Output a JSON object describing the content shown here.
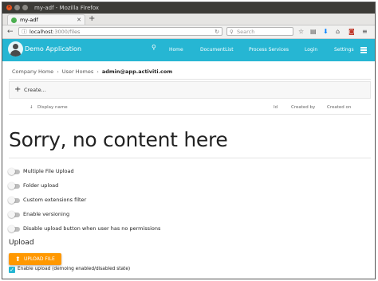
{
  "window": {
    "title": "my-adf - Mozilla Firefox"
  },
  "browser": {
    "tab_title": "my-adf",
    "url_host": "localhost",
    "url_path": ":3000/files",
    "search_placeholder": "Search"
  },
  "app": {
    "brand": "Demo Application",
    "menu": [
      "Home",
      "DocumentList",
      "Process Services",
      "Login",
      "Settings"
    ]
  },
  "breadcrumb": [
    "Company Home",
    "User Homes",
    "admin@app.activiti.com"
  ],
  "create_label": "Create...",
  "table": {
    "columns": [
      "Display name",
      "Id",
      "Created by",
      "Created on"
    ]
  },
  "empty_message": "Sorry, no content here",
  "toggles": [
    {
      "label": "Multiple File Upload",
      "on": false
    },
    {
      "label": "Folder upload",
      "on": false
    },
    {
      "label": "Custom extensions filter",
      "on": false
    },
    {
      "label": "Enable versioning",
      "on": false
    },
    {
      "label": "Disable upload button when user has no permissions",
      "on": false
    }
  ],
  "upload": {
    "title": "Upload",
    "button_label": "UPLOAD FILE",
    "checkbox_label": "Enable upload (demoing enabled/disabled state)",
    "checkbox_checked": true
  },
  "colors": {
    "appbar": "#26b6d3",
    "upload_button": "#ff9800",
    "checkbox": "#26b6d3"
  },
  "icons": [
    "close-icon",
    "minimize-icon",
    "maximize-icon",
    "info-icon",
    "reload-icon",
    "search-icon",
    "star-icon",
    "library-icon",
    "download-icon",
    "home-icon",
    "pocket-icon",
    "menu-icon",
    "user-avatar",
    "plus-icon",
    "sort-arrow-icon",
    "upload-icon",
    "checkmark-icon"
  ]
}
